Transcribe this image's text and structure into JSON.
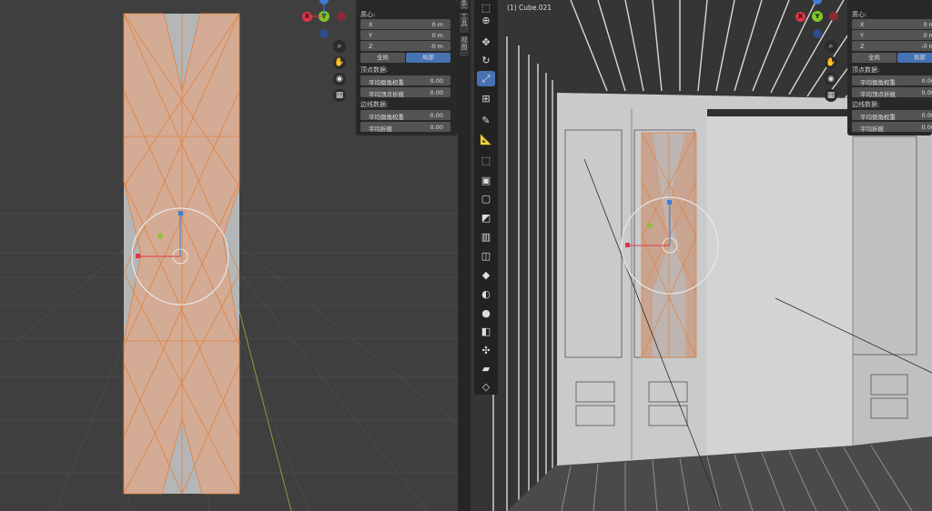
{
  "left_viewport": {
    "sidebar": {
      "header": "质心:",
      "fields": [
        {
          "label": "X",
          "value": "0 m"
        },
        {
          "label": "Y",
          "value": "0 m"
        },
        {
          "label": "Z",
          "value": "-0 m"
        }
      ],
      "toggle_global": "全局",
      "toggle_local": "局部",
      "vertex_header": "顶点数据:",
      "vertex_fields": [
        {
          "label": "平均倒角权重",
          "value": "0.00"
        },
        {
          "label": "平均顶点折痕",
          "value": "0.00"
        }
      ],
      "edge_header": "边线数据:",
      "edge_fields": [
        {
          "label": "平均倒角权重",
          "value": "0.00"
        },
        {
          "label": "平均折痕",
          "value": "0.00"
        }
      ]
    },
    "gizmo": {
      "x": "X",
      "y": "Y",
      "z": "Z"
    }
  },
  "side_tabs": [
    "条目",
    "工具",
    "视图"
  ],
  "right_viewport": {
    "object_label": "(1) Cube.021",
    "sidebar": {
      "header": "质心:",
      "fields": [
        {
          "label": "X",
          "value": "0 m"
        },
        {
          "label": "Y",
          "value": "0 m"
        },
        {
          "label": "Z",
          "value": "-0 m"
        }
      ],
      "toggle_global": "全局",
      "toggle_local": "局部",
      "vertex_header": "顶点数据:",
      "vertex_fields": [
        {
          "label": "平均倒角权重",
          "value": "0.00"
        },
        {
          "label": "平均顶点折痕",
          "value": "0.00"
        }
      ],
      "edge_header": "边线数据:",
      "edge_fields": [
        {
          "label": "平均倒角权重",
          "value": "0.00"
        },
        {
          "label": "平均折痕",
          "value": "0.00"
        }
      ]
    },
    "gizmo": {
      "x": "X",
      "y": "Y",
      "z": "Z"
    }
  },
  "toolbar_tools": [
    {
      "icon": "select-box-icon",
      "glyph": "⬚",
      "active": false
    },
    {
      "icon": "cursor-icon",
      "glyph": "⊕",
      "active": false
    },
    {
      "icon": "move-icon",
      "glyph": "✥",
      "active": false
    },
    {
      "icon": "rotate-icon",
      "glyph": "↻",
      "active": false
    },
    {
      "icon": "scale-icon",
      "glyph": "⤢",
      "active": true
    },
    {
      "icon": "transform-icon",
      "glyph": "⊞",
      "active": false
    },
    {
      "icon": "annotate-icon",
      "glyph": "✎",
      "active": false
    },
    {
      "icon": "measure-icon",
      "glyph": "📐",
      "active": false
    },
    {
      "icon": "add-cube-icon",
      "glyph": "⬚",
      "active": false
    },
    {
      "icon": "extrude-icon",
      "glyph": "▣",
      "active": false
    },
    {
      "icon": "inset-icon",
      "glyph": "▢",
      "active": false
    },
    {
      "icon": "bevel-icon",
      "glyph": "◩",
      "active": false
    },
    {
      "icon": "loop-cut-icon",
      "glyph": "▥",
      "active": false
    },
    {
      "icon": "knife-icon",
      "glyph": "◫",
      "active": false
    },
    {
      "icon": "poly-build-icon",
      "glyph": "◆",
      "active": false
    },
    {
      "icon": "spin-icon",
      "glyph": "◐",
      "active": false
    },
    {
      "icon": "smooth-icon",
      "glyph": "●",
      "active": false
    },
    {
      "icon": "edge-slide-icon",
      "glyph": "◧",
      "active": false
    },
    {
      "icon": "shrink-fatten-icon",
      "glyph": "✣",
      "active": false
    },
    {
      "icon": "shear-icon",
      "glyph": "▰",
      "active": false
    },
    {
      "icon": "rip-icon",
      "glyph": "◇",
      "active": false
    }
  ],
  "colors": {
    "x_axis": "#e0344a",
    "y_axis": "#7ec52a",
    "z_axis": "#3d7dd8",
    "active_tool": "#4772b3",
    "selection_face": "#d9a98e",
    "selection_edge": "#e0823d"
  }
}
